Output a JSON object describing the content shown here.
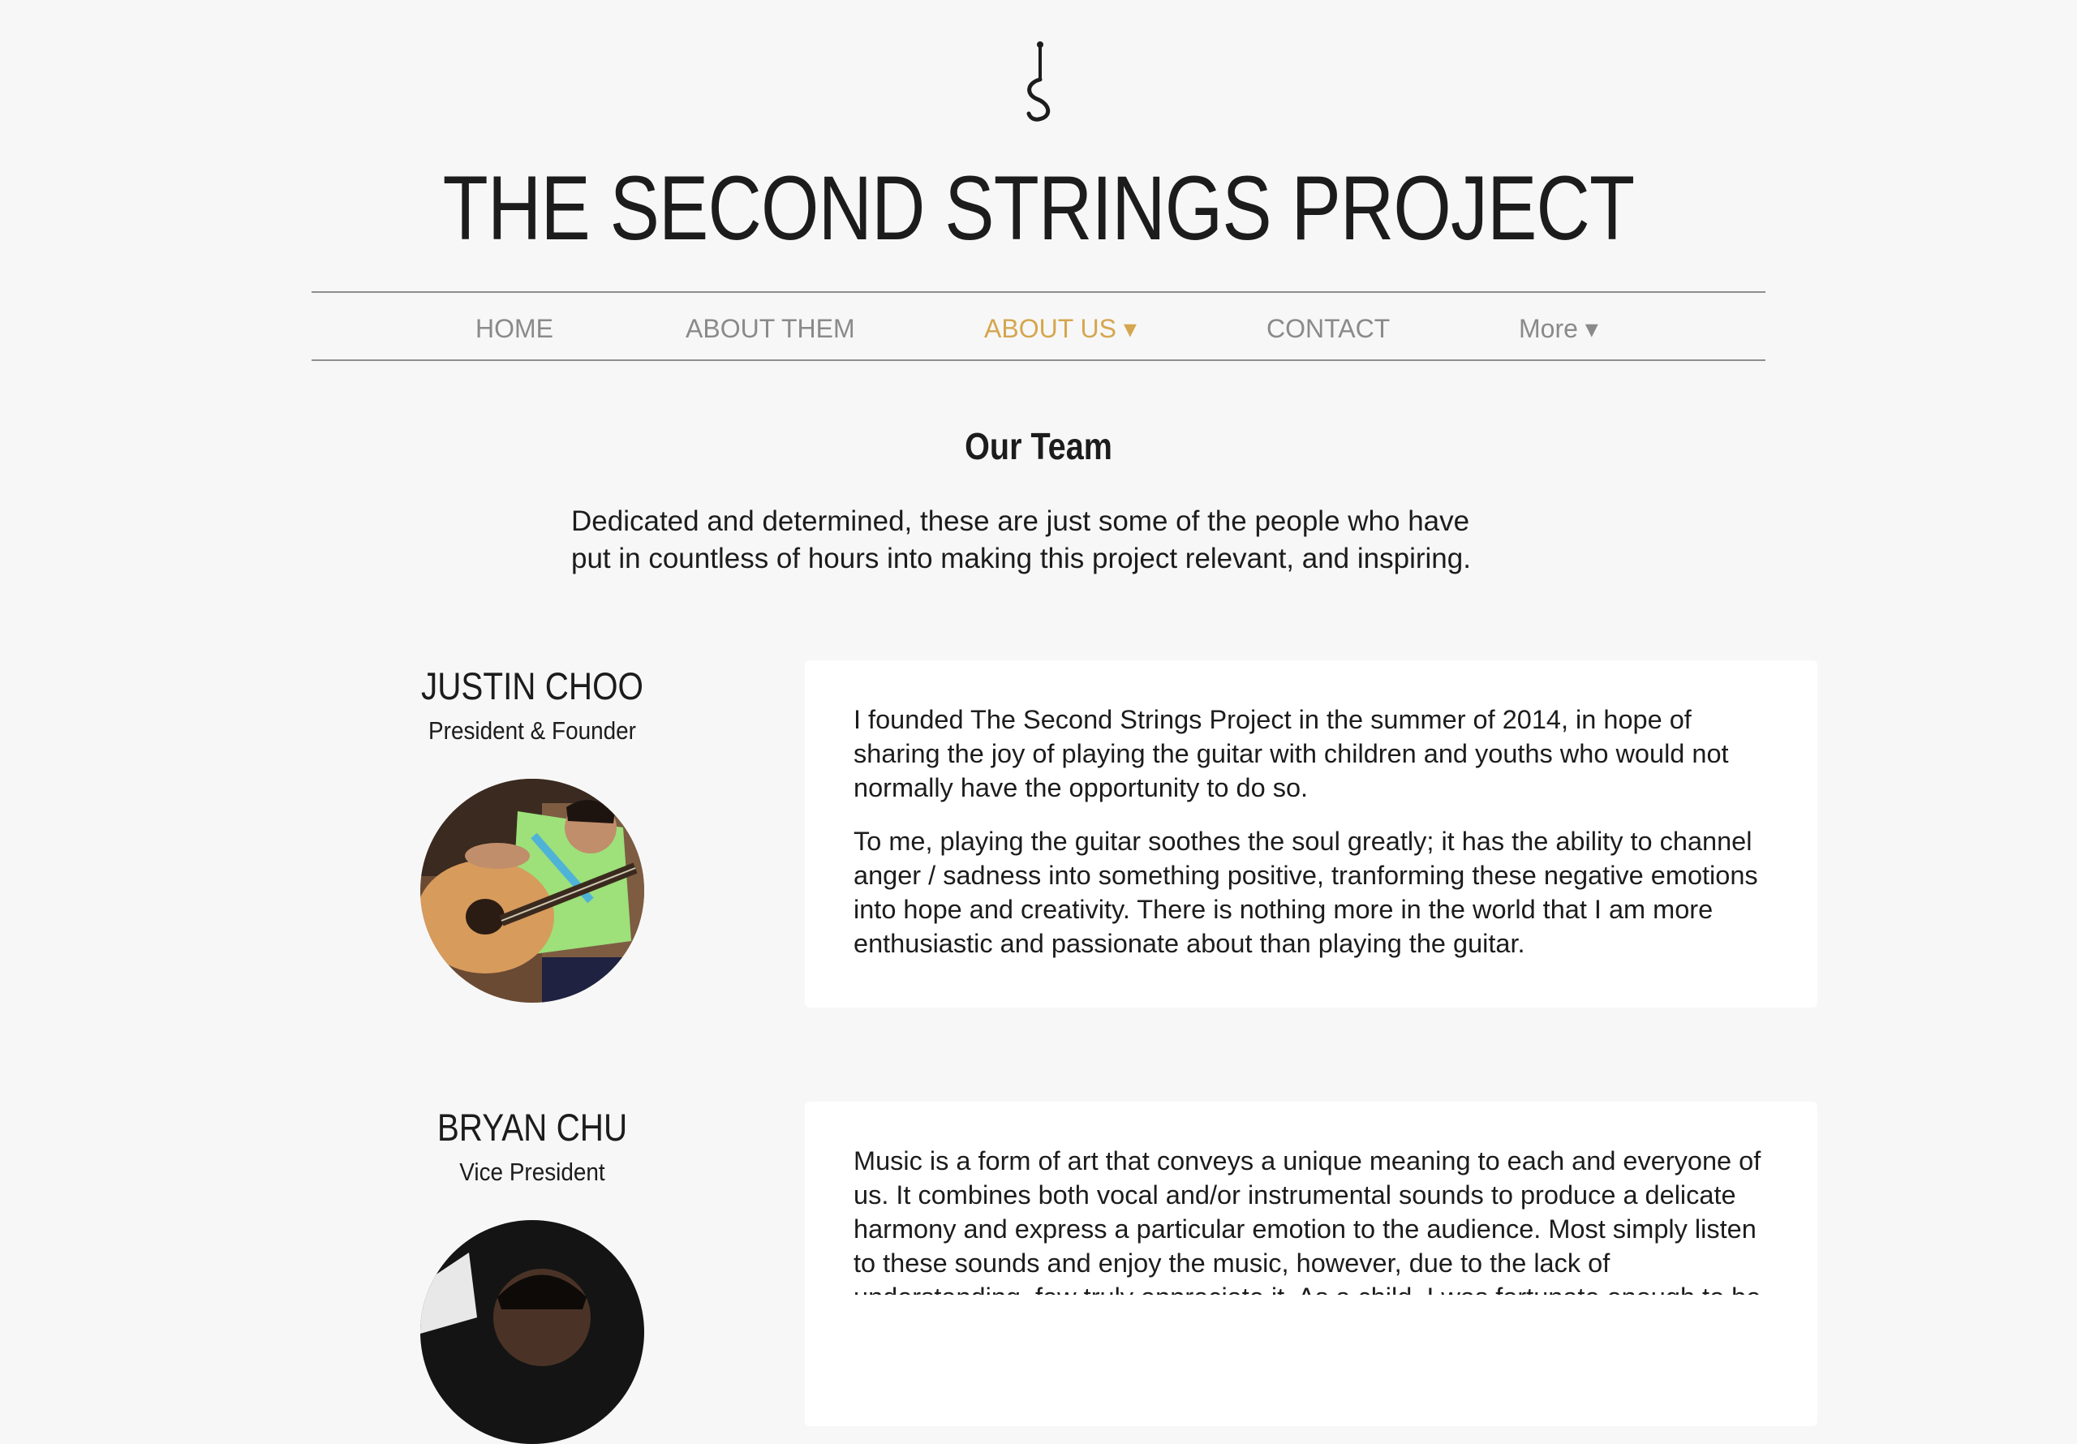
{
  "site": {
    "title": "THE SECOND STRINGS PROJECT",
    "logo_icon": "guitar-string-logo-icon"
  },
  "nav": {
    "items": [
      {
        "label": "HOME",
        "active": false
      },
      {
        "label": "ABOUT THEM",
        "active": false
      },
      {
        "label": "ABOUT US ▾",
        "active": true
      },
      {
        "label": "CONTACT",
        "active": false
      },
      {
        "label": "More ▾",
        "active": false
      }
    ]
  },
  "colors": {
    "background": "#f7f7f7",
    "accent": "#d5a64f",
    "nav_text": "#8a8a8a",
    "card": "#ffffff"
  },
  "section": {
    "heading": "Our Team",
    "intro_line1": "Dedicated and determined, these are just some of the people who have",
    "intro_line2": "put in countless of hours into making this project relevant, and inspiring."
  },
  "members": [
    {
      "name": "JUSTIN CHOO",
      "role": "President & Founder",
      "paragraphs": [
        "I founded The Second Strings Project in the summer of 2014, in hope of sharing the joy of playing the guitar with children and youths who would not normally have the opportunity to do so.",
        "To me, playing the guitar soothes the soul greatly; it has the ability to channel anger / sadness into something positive, tranforming these negative emotions into hope and creativity. There is nothing more in the world that I am more enthusiastic and passionate about than playing the guitar."
      ]
    },
    {
      "name": "BRYAN CHU",
      "role": "Vice President",
      "paragraphs": [
        "Music is a form of art that conveys a unique meaning to each and everyone of us. It combines both vocal and/or instrumental sounds to produce a delicate harmony and express a particular emotion to the audience. Most simply listen to these sounds and enjoy the music, however, due to the lack of understanding, few truly appreciate it. As a child, I was fortunate enough to be"
      ]
    }
  ]
}
